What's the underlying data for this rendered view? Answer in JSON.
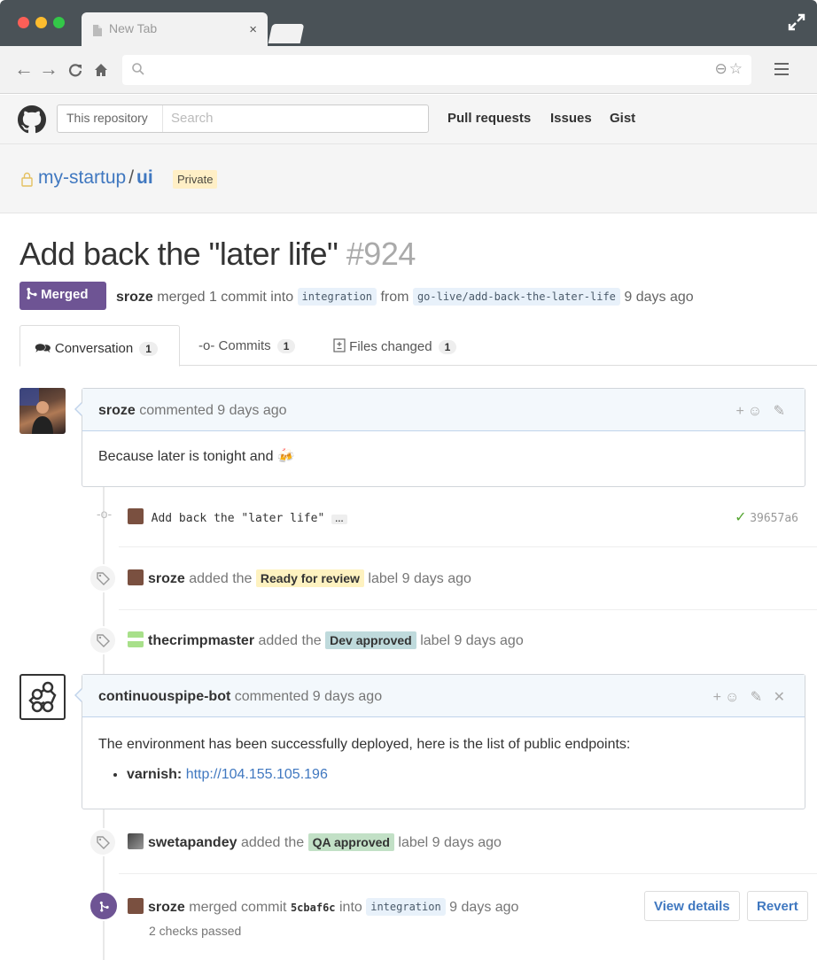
{
  "browser": {
    "tab_title": "New Tab",
    "tab_close": "×"
  },
  "github": {
    "search_scope": "This repository",
    "search_placeholder": "Search",
    "nav": [
      "Pull requests",
      "Issues",
      "Gist"
    ]
  },
  "repo": {
    "owner": "my-startup",
    "separator": "/",
    "name": "ui",
    "visibility": "Private"
  },
  "pr": {
    "title": "Add back the \"later life\"",
    "number": "#924",
    "state": "Merged",
    "author": "sroze",
    "merged_text": "merged 1 commit into",
    "base_branch": "integration",
    "from_text": "from",
    "head_branch": "go-live/add-back-the-later-life",
    "time": "9 days ago"
  },
  "tabs": [
    {
      "label": "Conversation",
      "count": "1"
    },
    {
      "label": "Commits",
      "count": "1"
    },
    {
      "label": "Files changed",
      "count": "1"
    }
  ],
  "timeline": {
    "comment1": {
      "author": "sroze",
      "action": "commented 9 days ago",
      "body": "Because later is tonight and 🍻"
    },
    "commit": {
      "message": "Add back the \"later life\"",
      "ellipsis": "…",
      "sha": "39657a6"
    },
    "label1": {
      "user": "sroze",
      "prefix": "added the",
      "label": "Ready for review",
      "suffix": "label 9 days ago",
      "color": "#fef2c0"
    },
    "label2": {
      "user": "thecrimpmaster",
      "prefix": "added the",
      "label": "Dev approved",
      "suffix": "label 9 days ago",
      "color": "#bfdadc"
    },
    "comment2": {
      "author": "continuouspipe-bot",
      "action": "commented 9 days ago",
      "body": "The environment has been successfully deployed, here is the list of public endpoints:",
      "endpoint_name": "varnish",
      "endpoint_separator": ":",
      "endpoint_url": "http://104.155.105.196"
    },
    "label3": {
      "user": "swetapandey",
      "prefix": "added the",
      "label": "QA approved",
      "suffix": "label 9 days ago",
      "color": "#c2e0c6"
    },
    "merge": {
      "user": "sroze",
      "text": "merged commit",
      "sha": "5cbaf6c",
      "into": "into",
      "branch": "integration",
      "time": "9 days ago",
      "checks": "2 checks passed",
      "view_details": "View details",
      "revert": "Revert"
    }
  },
  "colors": {
    "merged_purple": "#6e5494",
    "link_blue": "#4078c0",
    "success_green": "#6cc644"
  }
}
